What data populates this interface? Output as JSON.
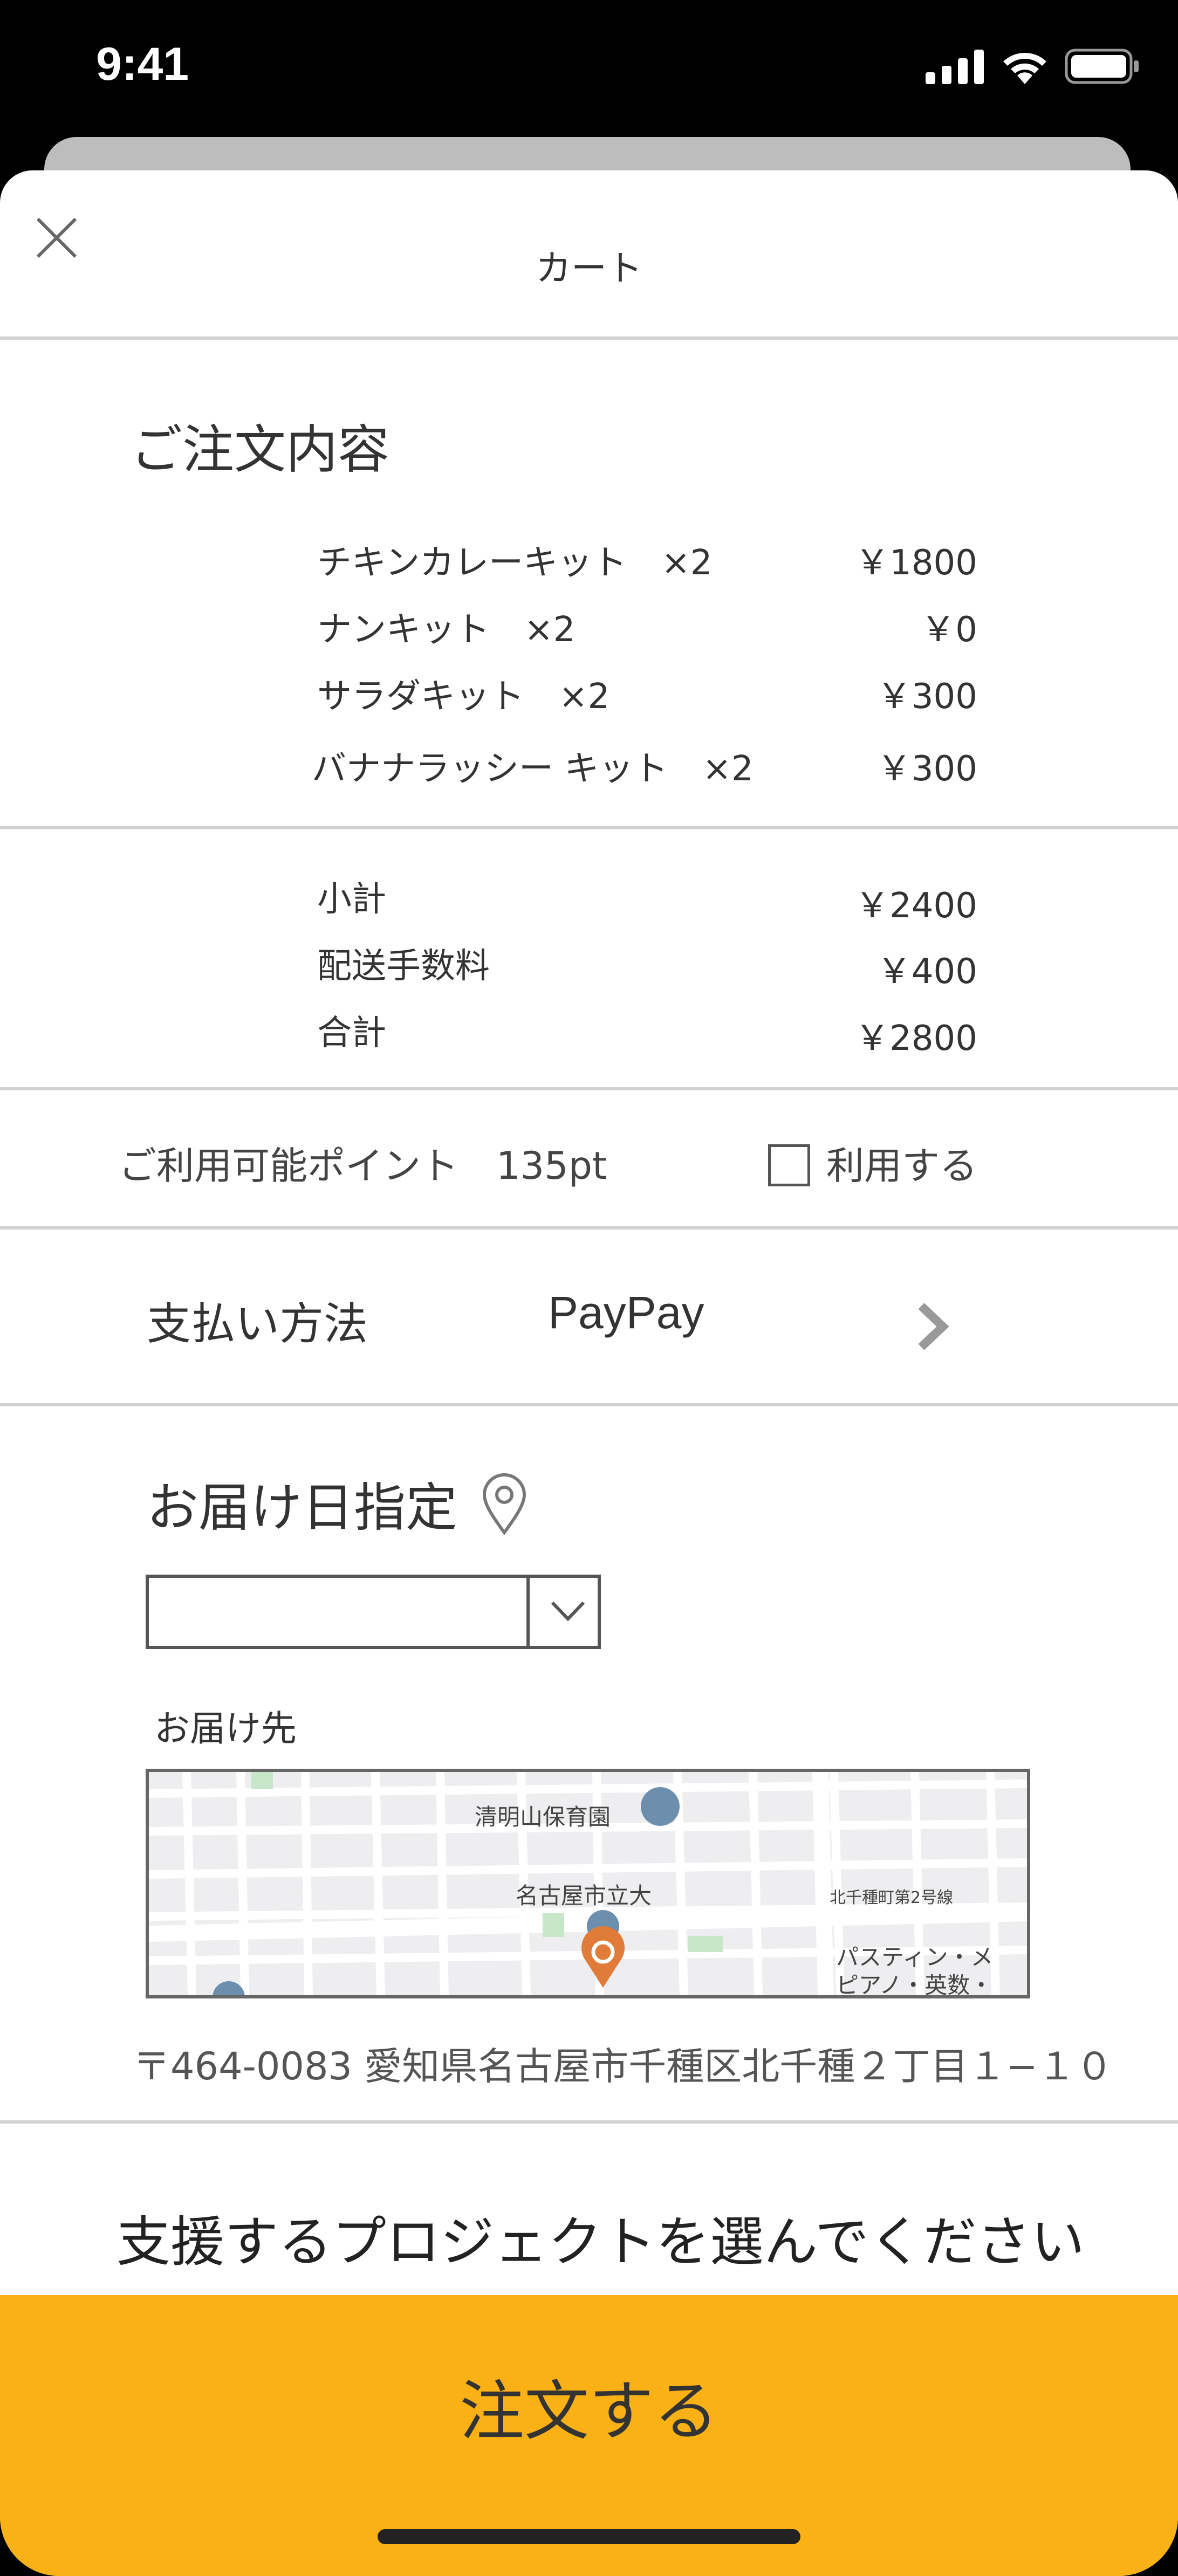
{
  "status_bar": {
    "time": "9:41"
  },
  "header": {
    "title": "カート"
  },
  "order": {
    "title": "ご注文内容",
    "items": [
      {
        "name": "チキンカレーキット　×2",
        "price": "￥1800"
      },
      {
        "name": "ナンキット　×2",
        "price": "￥0"
      },
      {
        "name": "サラダキット　×2",
        "price": "￥300"
      },
      {
        "name": "バナナラッシー キット　×2",
        "price": "￥300"
      }
    ]
  },
  "totals": [
    {
      "label": "小計",
      "value": "￥2400"
    },
    {
      "label": "配送手数料",
      "value": "￥400"
    },
    {
      "label": "合計",
      "value": "￥2800"
    }
  ],
  "points": {
    "label": "ご利用可能ポイント　135pt",
    "use_label": "利用する",
    "checked": false
  },
  "payment": {
    "label": "支払い方法",
    "value": "PayPay"
  },
  "delivery": {
    "date_title": "お届け日指定",
    "date_value": "",
    "destination_label": "お届け先",
    "map_labels": {
      "nursery": "清明山保育園",
      "school": "名古屋市立大",
      "road": "北千種町第2号線",
      "piano_1": "パスティン・メ",
      "piano_2": "ピアノ・英数・"
    },
    "address": "〒464-0083 愛知県名古屋市千種区北千種２丁目１−１０"
  },
  "project": {
    "title": "支援するプロジェクトを選んでください"
  },
  "order_button": {
    "label": "注文する",
    "color": "#f9b115"
  }
}
